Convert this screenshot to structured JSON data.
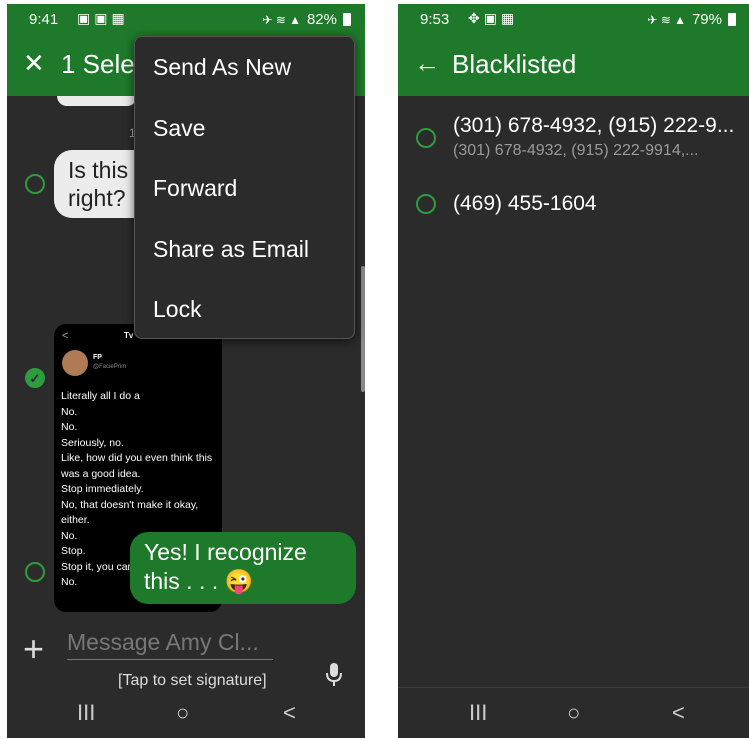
{
  "left": {
    "status": {
      "time": "9:41",
      "battery": "82%"
    },
    "appbar": {
      "title": "1 Sele"
    },
    "convo": {
      "timestamp_fragment": "1",
      "incoming_message": [
        "Is this",
        "right?"
      ],
      "screenshot": {
        "back": "<",
        "brand": "Tv",
        "name": "FP",
        "handle": "@FaciePrim",
        "lines": [
          "Literally all I do a",
          "No.",
          "No.",
          "Seriously, no.",
          "Like, how did you even think this",
          "was a good idea.",
          "Stop immediately.",
          "No, that doesn't make it okay,",
          "either.",
          "No.",
          "Stop.",
          "Stop it, you can't do that.",
          "No."
        ]
      },
      "outgoing_message": [
        "Yes! I recognize",
        "this . . . 😜"
      ]
    },
    "menu": [
      "Send As New",
      "Save",
      "Forward",
      "Share as Email",
      "Lock"
    ],
    "composer": {
      "placeholder": "Message Amy Cl...",
      "signature": "[Tap to set signature]"
    }
  },
  "right": {
    "status": {
      "time": "9:53",
      "battery": "79%"
    },
    "appbar": {
      "title": "Blacklisted"
    },
    "items": [
      {
        "primary": "(301) 678-4932, (915) 222-9...",
        "secondary": "(301) 678-4932, (915) 222-9914,..."
      },
      {
        "primary": "(469) 455-1604",
        "secondary": ""
      }
    ]
  },
  "nav_glyphs": {
    "recents": "III",
    "home": "○",
    "back": "<"
  },
  "colors": {
    "accent": "#1e7a2a",
    "background": "#2b2b2b",
    "radio": "#2e9b3f"
  }
}
